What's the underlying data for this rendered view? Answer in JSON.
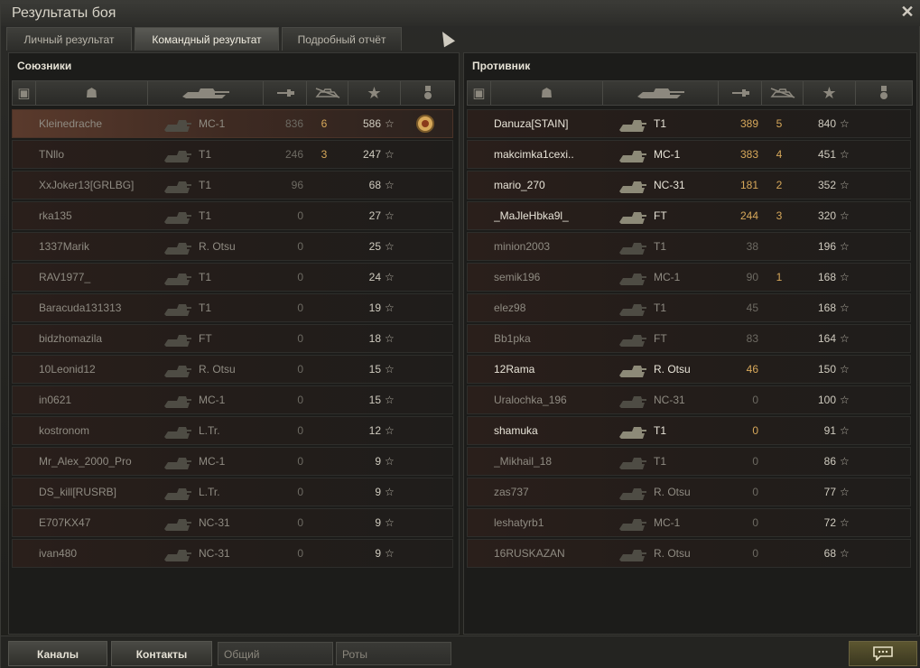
{
  "window": {
    "title": "Результаты боя"
  },
  "tabs": [
    {
      "label": "Личный результат",
      "active": false
    },
    {
      "label": "Командный результат",
      "active": true
    },
    {
      "label": "Подробный отчёт",
      "active": false
    }
  ],
  "allies": {
    "title": "Союзники",
    "rows": [
      {
        "name": "Kleinedrache",
        "tank": "MC-1",
        "damage": "836",
        "kills": "6",
        "xp": "586",
        "alive": false,
        "highlight": true,
        "medal": true
      },
      {
        "name": "TNllo",
        "tank": "T1",
        "damage": "246",
        "kills": "3",
        "xp": "247",
        "alive": false
      },
      {
        "name": "XxJoker13[GRLBG]",
        "tank": "T1",
        "damage": "96",
        "kills": "",
        "xp": "68",
        "alive": false
      },
      {
        "name": "rka135",
        "tank": "T1",
        "damage": "0",
        "kills": "",
        "xp": "27",
        "alive": false
      },
      {
        "name": "1337Marik",
        "tank": "R. Otsu",
        "damage": "0",
        "kills": "",
        "xp": "25",
        "alive": false
      },
      {
        "name": "RAV1977_",
        "tank": "T1",
        "damage": "0",
        "kills": "",
        "xp": "24",
        "alive": false
      },
      {
        "name": "Baracuda131313",
        "tank": "T1",
        "damage": "0",
        "kills": "",
        "xp": "19",
        "alive": false
      },
      {
        "name": "bidzhomazila",
        "tank": "FT",
        "damage": "0",
        "kills": "",
        "xp": "18",
        "alive": false
      },
      {
        "name": "10Leonid12",
        "tank": "R. Otsu",
        "damage": "0",
        "kills": "",
        "xp": "15",
        "alive": false
      },
      {
        "name": "in0621",
        "tank": "MC-1",
        "damage": "0",
        "kills": "",
        "xp": "15",
        "alive": false
      },
      {
        "name": "kostronom",
        "tank": "L.Tr.",
        "damage": "0",
        "kills": "",
        "xp": "12",
        "alive": false
      },
      {
        "name": "Mr_Alex_2000_Pro",
        "tank": "MC-1",
        "damage": "0",
        "kills": "",
        "xp": "9",
        "alive": false
      },
      {
        "name": "DS_kill[RUSRB]",
        "tank": "L.Tr.",
        "damage": "0",
        "kills": "",
        "xp": "9",
        "alive": false
      },
      {
        "name": "E707KX47",
        "tank": "NC-31",
        "damage": "0",
        "kills": "",
        "xp": "9",
        "alive": false
      },
      {
        "name": "ivan480",
        "tank": "NC-31",
        "damage": "0",
        "kills": "",
        "xp": "9",
        "alive": false
      }
    ]
  },
  "enemies": {
    "title": "Противник",
    "rows": [
      {
        "name": "Danuza[STAIN]",
        "tank": "T1",
        "damage": "389",
        "kills": "5",
        "xp": "840",
        "alive": true
      },
      {
        "name": "makcimka1cexi..",
        "tank": "MC-1",
        "damage": "383",
        "kills": "4",
        "xp": "451",
        "alive": true
      },
      {
        "name": "mario_270",
        "tank": "NC-31",
        "damage": "181",
        "kills": "2",
        "xp": "352",
        "alive": true
      },
      {
        "name": "_MaJleHbka9l_",
        "tank": "FT",
        "damage": "244",
        "kills": "3",
        "xp": "320",
        "alive": true
      },
      {
        "name": "minion2003",
        "tank": "T1",
        "damage": "38",
        "kills": "",
        "xp": "196",
        "alive": false
      },
      {
        "name": "semik196",
        "tank": "MC-1",
        "damage": "90",
        "kills": "1",
        "xp": "168",
        "alive": false
      },
      {
        "name": "elez98",
        "tank": "T1",
        "damage": "45",
        "kills": "",
        "xp": "168",
        "alive": false
      },
      {
        "name": "Bb1pka",
        "tank": "FT",
        "damage": "83",
        "kills": "",
        "xp": "164",
        "alive": false
      },
      {
        "name": "12Rama",
        "tank": "R. Otsu",
        "damage": "46",
        "kills": "",
        "xp": "150",
        "alive": true
      },
      {
        "name": "Uralochka_196",
        "tank": "NC-31",
        "damage": "0",
        "kills": "",
        "xp": "100",
        "alive": false
      },
      {
        "name": "shamuka",
        "tank": "T1",
        "damage": "0",
        "kills": "",
        "xp": "91",
        "alive": true
      },
      {
        "name": "_Mikhail_18",
        "tank": "T1",
        "damage": "0",
        "kills": "",
        "xp": "86",
        "alive": false
      },
      {
        "name": "zas737",
        "tank": "R. Otsu",
        "damage": "0",
        "kills": "",
        "xp": "77",
        "alive": false
      },
      {
        "name": "leshatyrb1",
        "tank": "MC-1",
        "damage": "0",
        "kills": "",
        "xp": "72",
        "alive": false
      },
      {
        "name": "16RUSKAZAN",
        "tank": "R. Otsu",
        "damage": "0",
        "kills": "",
        "xp": "68",
        "alive": false
      }
    ]
  },
  "icons": {
    "platoon": "platoon-icon",
    "player": "player-icon",
    "tank": "tank-icon",
    "damage": "damage-icon",
    "kills": "kills-icon",
    "xp": "star-icon",
    "medal": "medal-icon",
    "close": "close-icon",
    "chat": "chat-icon"
  },
  "symbols": {
    "star": "☆",
    "close": "✕",
    "chat": "💬",
    "person": "☗",
    "shield": "▣"
  },
  "bottom": {
    "channels_label": "Каналы",
    "contacts_label": "Контакты",
    "common_label": "Общий",
    "companies_label": "Роты"
  },
  "colors": {
    "kills": "#d7a85a",
    "highlight": "#5a3a2c",
    "chat_button": "#5c5630"
  }
}
